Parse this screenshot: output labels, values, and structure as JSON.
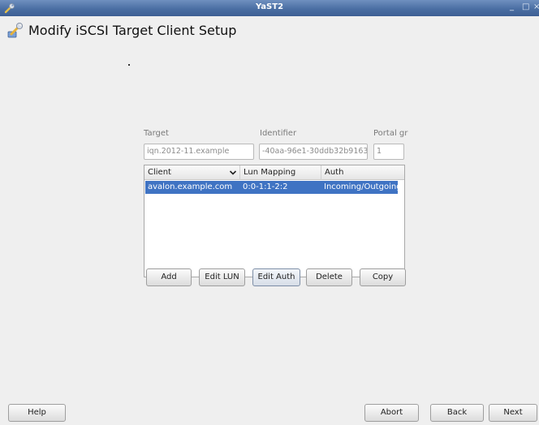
{
  "window": {
    "title": "YaST2",
    "controls": [
      "_",
      "□",
      "×"
    ]
  },
  "header": {
    "title": "Modify iSCSI Target Client Setup"
  },
  "target": {
    "label": "Target",
    "value": "iqn.2012-11.example"
  },
  "identifier": {
    "label": "Identifier",
    "value": "-40aa-96e1-30ddb32b9163"
  },
  "portal_group": {
    "label": "Portal gr",
    "value": "1"
  },
  "clients_table": {
    "columns": [
      "Client",
      "Lun Mapping",
      "Auth"
    ],
    "rows": [
      {
        "client": "avalon.example.com",
        "lun_mapping": "0:0-1:1-2:2",
        "auth": "Incoming/Outgoing"
      }
    ]
  },
  "actions": {
    "add": "Add",
    "edit_lun": "Edit LUN",
    "edit_auth": "Edit Auth",
    "delete": "Delete",
    "copy": "Copy"
  },
  "footer": {
    "help": "Help",
    "abort": "Abort",
    "back": "Back",
    "next": "Next"
  },
  "colors": {
    "titlebar": "#4a6ea3",
    "selection": "#3f73c3",
    "background": "#efefef"
  }
}
